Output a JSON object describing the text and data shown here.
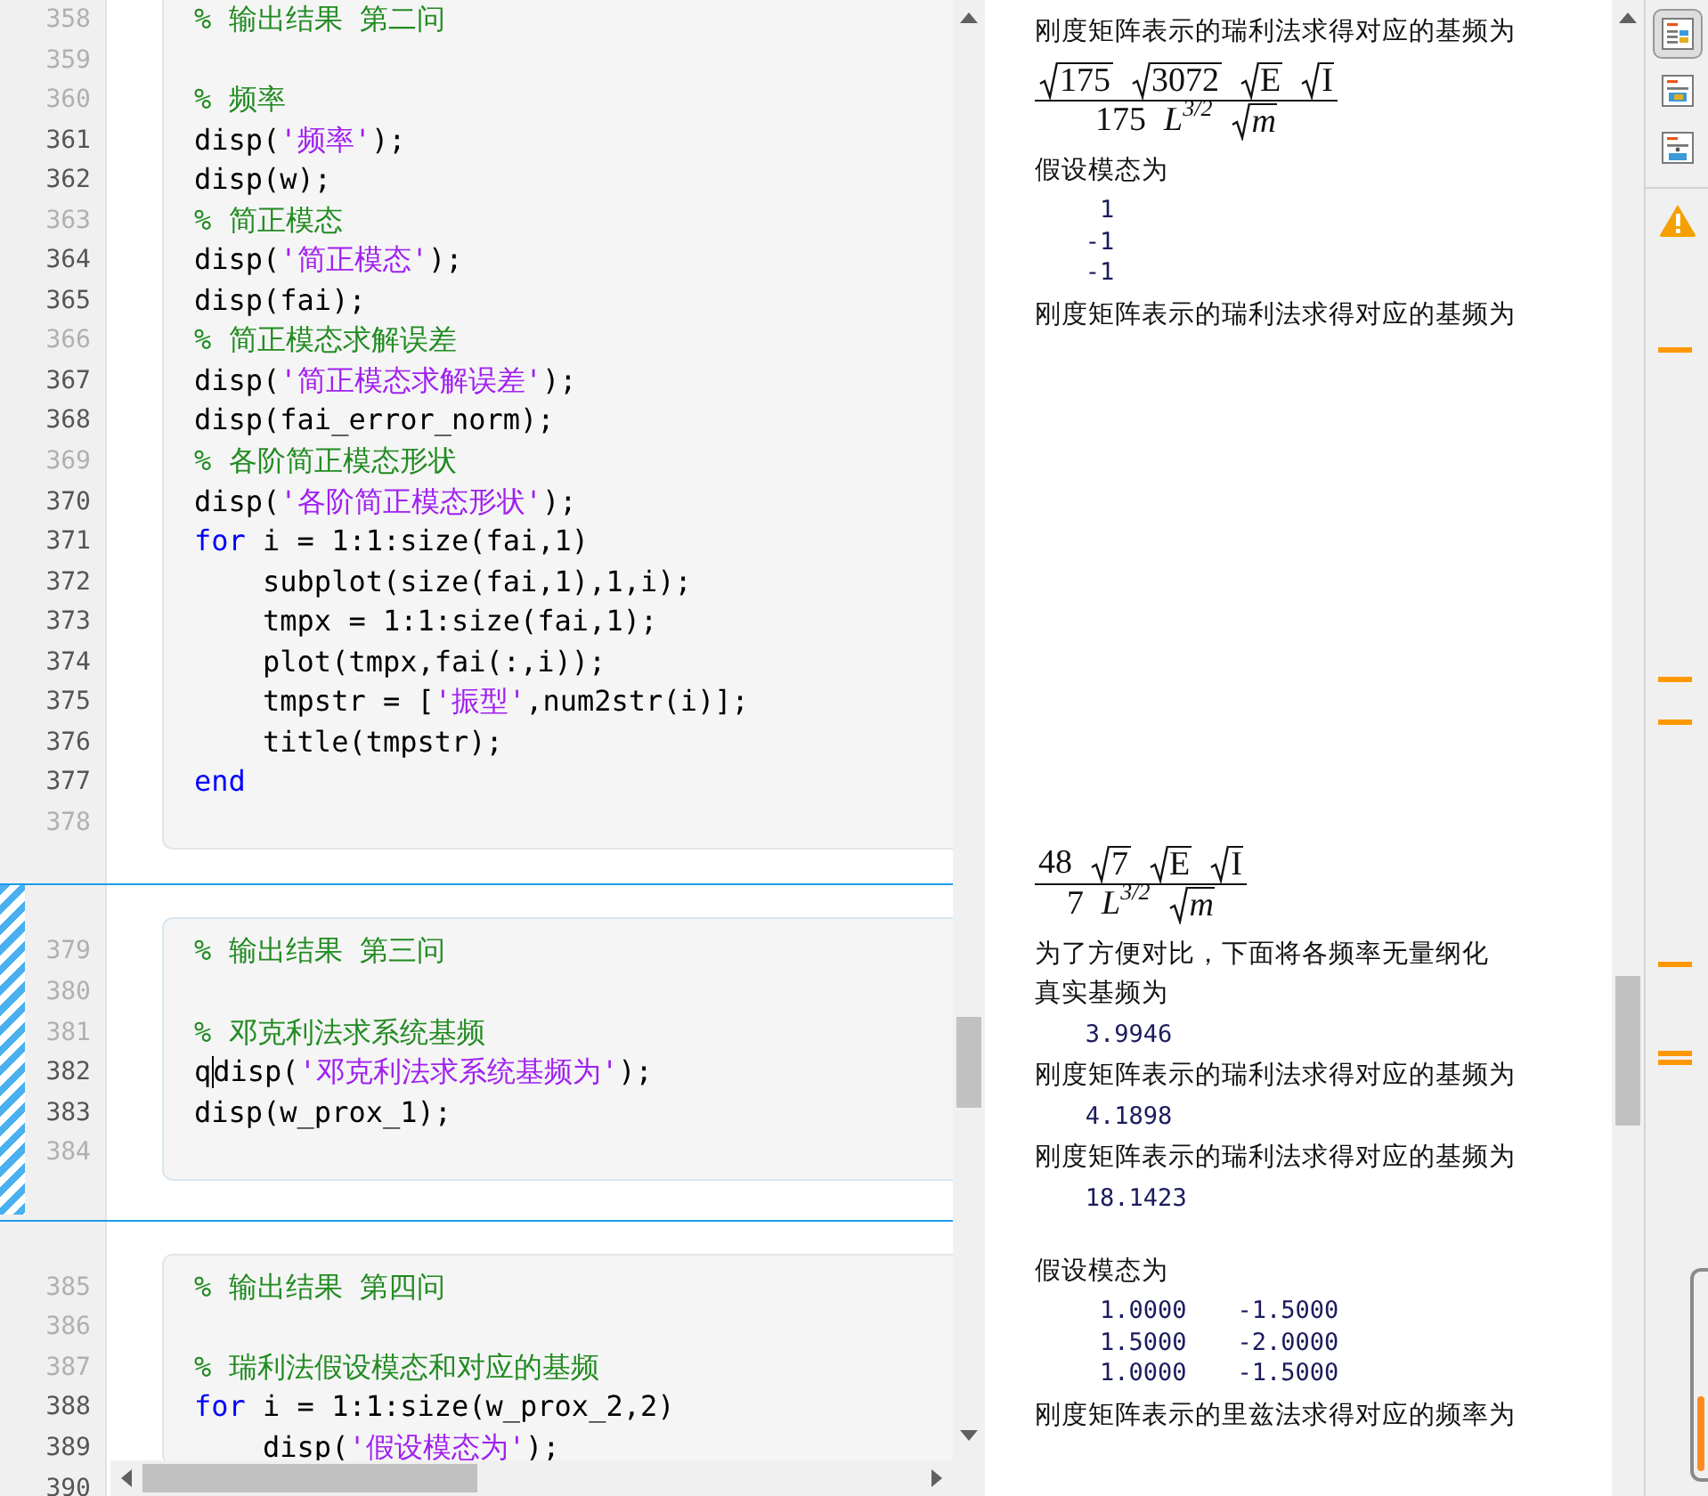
{
  "code_sections": [
    {
      "selected": false,
      "lines": [
        {
          "number": "358",
          "executable": false,
          "tokens": [
            {
              "kind": "comment",
              "text": "% 输出结果 第二问"
            }
          ]
        },
        {
          "number": "359",
          "executable": false
        },
        {
          "number": "360",
          "executable": false,
          "tokens": [
            {
              "kind": "comment",
              "text": "% 频率"
            }
          ]
        },
        {
          "number": "361",
          "executable": true,
          "tokens": [
            {
              "kind": "plain",
              "text": "disp("
            },
            {
              "kind": "string",
              "text": "'频率'"
            },
            {
              "kind": "plain",
              "text": ");"
            }
          ]
        },
        {
          "number": "362",
          "executable": true,
          "tokens": [
            {
              "kind": "plain",
              "text": "disp(w);"
            }
          ]
        },
        {
          "number": "363",
          "executable": false,
          "tokens": [
            {
              "kind": "comment",
              "text": "% 简正模态"
            }
          ]
        },
        {
          "number": "364",
          "executable": true,
          "tokens": [
            {
              "kind": "plain",
              "text": "disp("
            },
            {
              "kind": "string",
              "text": "'简正模态'"
            },
            {
              "kind": "plain",
              "text": ");"
            }
          ]
        },
        {
          "number": "365",
          "executable": true,
          "tokens": [
            {
              "kind": "plain",
              "text": "disp(fai);"
            }
          ]
        },
        {
          "number": "366",
          "executable": false,
          "tokens": [
            {
              "kind": "comment",
              "text": "% 简正模态求解误差"
            }
          ]
        },
        {
          "number": "367",
          "executable": true,
          "tokens": [
            {
              "kind": "plain",
              "text": "disp("
            },
            {
              "kind": "string",
              "text": "'简正模态求解误差'"
            },
            {
              "kind": "plain",
              "text": ");"
            }
          ]
        },
        {
          "number": "368",
          "executable": true,
          "tokens": [
            {
              "kind": "plain",
              "text": "disp(fai_error_norm);"
            }
          ]
        },
        {
          "number": "369",
          "executable": false,
          "tokens": [
            {
              "kind": "comment",
              "text": "% 各阶简正模态形状"
            }
          ]
        },
        {
          "number": "370",
          "executable": true,
          "tokens": [
            {
              "kind": "plain",
              "text": "disp("
            },
            {
              "kind": "string",
              "text": "'各阶简正模态形状'"
            },
            {
              "kind": "plain",
              "text": ");"
            }
          ]
        },
        {
          "number": "371",
          "executable": true,
          "tokens": [
            {
              "kind": "keyword",
              "text": "for"
            },
            {
              "kind": "plain",
              "text": " i = 1:1:size(fai,1)"
            }
          ]
        },
        {
          "number": "372",
          "executable": true,
          "tokens": [
            {
              "kind": "plain",
              "text": "    subplot(size(fai,1),1,i);"
            }
          ]
        },
        {
          "number": "373",
          "executable": true,
          "tokens": [
            {
              "kind": "plain",
              "text": "    tmpx = 1:1:size(fai,1);"
            }
          ]
        },
        {
          "number": "374",
          "executable": true,
          "tokens": [
            {
              "kind": "plain",
              "text": "    plot(tmpx,fai(:,i));"
            }
          ]
        },
        {
          "number": "375",
          "executable": true,
          "tokens": [
            {
              "kind": "plain",
              "text": "    tmpstr = ["
            },
            {
              "kind": "string",
              "text": "'振型'"
            },
            {
              "kind": "plain",
              "text": ",num2str(i)];"
            }
          ]
        },
        {
          "number": "376",
          "executable": true,
          "tokens": [
            {
              "kind": "plain",
              "text": "    title(tmpstr);"
            }
          ]
        },
        {
          "number": "377",
          "executable": true,
          "tokens": [
            {
              "kind": "keyword",
              "text": "end"
            }
          ]
        },
        {
          "number": "378",
          "executable": false
        }
      ]
    },
    {
      "selected": true,
      "lines": [
        {
          "number": "379",
          "executable": false,
          "tokens": [
            {
              "kind": "comment",
              "text": "% 输出结果 第三问"
            }
          ]
        },
        {
          "number": "380",
          "executable": false
        },
        {
          "number": "381",
          "executable": false,
          "tokens": [
            {
              "kind": "comment",
              "text": "% 邓克利法求系统基频"
            }
          ]
        },
        {
          "number": "382",
          "executable": true,
          "tokens": [
            {
              "kind": "plain",
              "text": "q"
            },
            {
              "kind": "caret"
            },
            {
              "kind": "plain",
              "text": "disp("
            },
            {
              "kind": "string",
              "text": "'邓克利法求系统基频为'"
            },
            {
              "kind": "plain",
              "text": ");"
            }
          ]
        },
        {
          "number": "383",
          "executable": true,
          "tokens": [
            {
              "kind": "plain",
              "text": "disp(w_prox_1);"
            }
          ]
        },
        {
          "number": "384",
          "executable": false
        }
      ]
    },
    {
      "selected": false,
      "lines": [
        {
          "number": "385",
          "executable": false,
          "tokens": [
            {
              "kind": "comment",
              "text": "% 输出结果 第四问"
            }
          ]
        },
        {
          "number": "386",
          "executable": false
        },
        {
          "number": "387",
          "executable": false,
          "tokens": [
            {
              "kind": "comment",
              "text": "% 瑞利法假设模态和对应的基频"
            }
          ]
        },
        {
          "number": "388",
          "executable": true,
          "tokens": [
            {
              "kind": "keyword",
              "text": "for"
            },
            {
              "kind": "plain",
              "text": " i = 1:1:size(w_prox_2,2)"
            }
          ]
        },
        {
          "number": "389",
          "executable": true,
          "tokens": [
            {
              "kind": "plain",
              "text": "    disp("
            },
            {
              "kind": "string",
              "text": "'假设模态为'"
            },
            {
              "kind": "plain",
              "text": ");"
            }
          ]
        },
        {
          "number": "390",
          "executable": true
        }
      ]
    }
  ],
  "output_groups": [
    {
      "items": [
        {
          "kind": "text",
          "text": "刚度矩阵表示的瑞利法求得对应的基频为"
        },
        {
          "kind": "math",
          "numerator": [
            {
              "radical": true,
              "text": "175"
            },
            {
              "radical": true,
              "text": "3072"
            },
            {
              "radical": true,
              "text": "E"
            },
            {
              "radical": true,
              "text": "I"
            }
          ],
          "denominator": [
            {
              "radical": false,
              "text": "175"
            },
            {
              "radical": false,
              "text": "L",
              "italic": true,
              "sup": "3/2"
            },
            {
              "radical": true,
              "text": "m",
              "italic": true
            }
          ]
        },
        {
          "kind": "text",
          "text": "假设模态为"
        },
        {
          "kind": "matrix",
          "rows": [
            [
              "1"
            ],
            [
              "-1"
            ],
            [
              "-1"
            ]
          ]
        },
        {
          "kind": "text",
          "text": "刚度矩阵表示的瑞利法求得对应的基频为"
        }
      ]
    },
    {
      "items": [
        {
          "kind": "math",
          "numerator": [
            {
              "radical": false,
              "text": "48"
            },
            {
              "radical": true,
              "text": "7"
            },
            {
              "radical": true,
              "text": "E"
            },
            {
              "radical": true,
              "text": "I"
            }
          ],
          "denominator": [
            {
              "radical": false,
              "text": "7"
            },
            {
              "radical": false,
              "text": "L",
              "italic": true,
              "sup": "3/2"
            },
            {
              "radical": true,
              "text": "m",
              "italic": true
            }
          ]
        },
        {
          "kind": "text",
          "text": "为了方便对比，下面将各频率无量纲化"
        },
        {
          "kind": "text",
          "text": "真实基频为"
        },
        {
          "kind": "matrix",
          "rows": [
            [
              "3.9946"
            ]
          ]
        },
        {
          "kind": "text",
          "text": "刚度矩阵表示的瑞利法求得对应的基频为"
        },
        {
          "kind": "matrix",
          "rows": [
            [
              "4.1898"
            ]
          ]
        },
        {
          "kind": "text",
          "text": "刚度矩阵表示的瑞利法求得对应的基频为"
        },
        {
          "kind": "matrix",
          "rows": [
            [
              "18.1423"
            ]
          ]
        }
      ]
    },
    {
      "items": [
        {
          "kind": "text",
          "text": "假设模态为"
        },
        {
          "kind": "matrix",
          "rows": [
            [
              "1.0000",
              "-1.5000"
            ],
            [
              "1.5000",
              "-2.0000"
            ],
            [
              "1.0000",
              "-1.5000"
            ]
          ]
        },
        {
          "kind": "text",
          "text": "刚度矩阵表示的里兹法求得对应的频率为"
        }
      ]
    }
  ],
  "view_buttons": [
    {
      "selected": true
    },
    {
      "selected": false
    },
    {
      "selected": false
    }
  ]
}
